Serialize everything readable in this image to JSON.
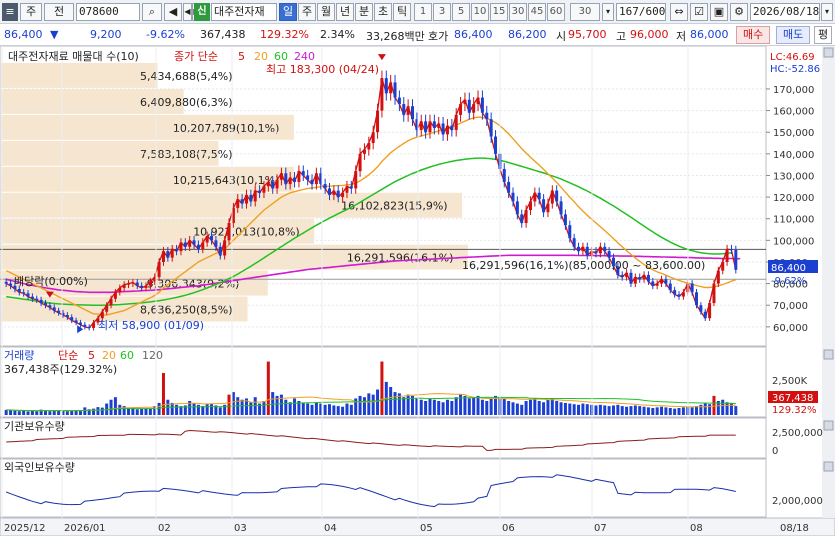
{
  "toolbar": {
    "menu_glyph": "≡",
    "type_label": "주",
    "mode_label": "전",
    "code": "078600",
    "search_glyph": "🔍",
    "sound_glyph": "◀",
    "nav_prev": "◀",
    "nav_next": "▶",
    "credit_badge": "신",
    "company_name": "대주전자재",
    "periods": [
      "일",
      "주",
      "월",
      "년",
      "분",
      "초",
      "틱"
    ],
    "active_period": "일",
    "minute_options": [
      "1",
      "3",
      "5",
      "10",
      "15",
      "30",
      "45",
      "60"
    ],
    "custom_value": "30",
    "count_display": "167/600",
    "date": "2026/08/18"
  },
  "quote": {
    "price": "86,400",
    "direction": "▼",
    "change": "9,200",
    "change_pct": "-9.62%",
    "volume": "367,438",
    "volume_ratio": "129.32%",
    "turnover_pct": "2.34%",
    "amount": "33,268백만",
    "ask_label": "호가",
    "ask": "86,400",
    "bid": "86,200",
    "open_label": "시",
    "open": "95,700",
    "high_label": "고",
    "high": "96,000",
    "low_label": "저",
    "low": "86,000",
    "buy_label": "매수",
    "sell_label": "매도",
    "eval_label": "평"
  },
  "colors": {
    "up": "#d21010",
    "down": "#1a3fd1",
    "ma5": "#d21010",
    "ma20": "#f0a020",
    "ma60": "#22c022",
    "ma240": "#d01ad0",
    "volbar": "#1a3fd1",
    "band": "#f6e6d0"
  },
  "main_panel": {
    "legend_title": "대주전자재료 매물대 수(10)",
    "legend_close": "종가 단순",
    "legend_ma": [
      "5",
      "20",
      "60",
      "240"
    ],
    "lc": "LC:46.69",
    "hc": "HC:-52.86",
    "high_mark": "최고 183,300 (04/24)",
    "low_mark": "최저 58,900 (01/09)",
    "dividend": "배당락(0.00%)",
    "current_price_tag": "86,400",
    "current_pct_tag": "-9.62%",
    "range_note": "16,291,596(16,1%)(85,000.00 ~ 83,600.00)"
  },
  "chart_data": {
    "type": "candlestick",
    "y_ticks": [
      60000,
      70000,
      80000,
      90000,
      100000,
      110000,
      120000,
      130000,
      140000,
      150000,
      160000,
      170000
    ],
    "y_tick_labels": [
      "60,000",
      "70,000",
      "80,000",
      "90,000",
      "100,000",
      "110,000",
      "120,000",
      "130,000",
      "140,000",
      "150,000",
      "160,000",
      "170,000"
    ],
    "ylim": [
      53000,
      188000
    ],
    "x_labels": [
      "2025/12",
      "2026/01",
      "02",
      "03",
      "04",
      "05",
      "06",
      "07",
      "08",
      "08/18"
    ],
    "volume_profile": [
      {
        "label": "5,434,688(5,4%)",
        "price": 176000,
        "ratio": 0.054
      },
      {
        "label": "6,409,880(6,3%)",
        "price": 164000,
        "ratio": 0.063
      },
      {
        "label": "10,207,789(10,1%)",
        "price": 152000,
        "ratio": 0.101
      },
      {
        "label": "7,583,108(7,5%)",
        "price": 140000,
        "ratio": 0.075
      },
      {
        "label": "10,215,643(10,1%)",
        "price": 128000,
        "ratio": 0.101
      },
      {
        "label": "16,102,823(15,9%)",
        "price": 116000,
        "ratio": 0.159
      },
      {
        "label": "10,922,013(10,8%)",
        "price": 104000,
        "ratio": 0.108
      },
      {
        "label": "16,291,596(16,1%)",
        "price": 92000,
        "ratio": 0.161
      },
      {
        "label": "9,306,343(9,2%)",
        "price": 80000,
        "ratio": 0.092
      },
      {
        "label": "8,636,250(8,5%)",
        "price": 68000,
        "ratio": 0.085
      }
    ],
    "close": [
      80000,
      79000,
      77500,
      76000,
      75500,
      74000,
      73000,
      72500,
      71000,
      70000,
      69000,
      67500,
      66500,
      65500,
      64500,
      63000,
      62000,
      61000,
      60000,
      59500,
      62000,
      64000,
      67000,
      70000,
      73000,
      76000,
      78000,
      79500,
      80000,
      80500,
      79000,
      78000,
      79000,
      81000,
      83000,
      90000,
      95000,
      92000,
      96000,
      95000,
      99000,
      97000,
      100000,
      98000,
      96000,
      99000,
      102000,
      100000,
      97000,
      93000,
      100000,
      108000,
      115000,
      119000,
      117000,
      121000,
      118000,
      123000,
      122000,
      125000,
      127000,
      124000,
      128000,
      131000,
      126000,
      129000,
      127000,
      132000,
      130000,
      128000,
      126000,
      131000,
      126000,
      124000,
      121000,
      123000,
      120000,
      122000,
      125000,
      124000,
      132000,
      140000,
      142000,
      145000,
      150000,
      160000,
      175000,
      168000,
      173000,
      166000,
      163000,
      158000,
      162000,
      156000,
      151000,
      155000,
      150000,
      155000,
      152000,
      154000,
      149000,
      153000,
      151000,
      158000,
      163000,
      165000,
      159000,
      163000,
      166000,
      159000,
      156000,
      148000,
      140000,
      133000,
      127000,
      122000,
      118000,
      112000,
      108000,
      114000,
      118000,
      122000,
      119000,
      113000,
      117000,
      123000,
      118000,
      112000,
      107000,
      101000,
      97000,
      95000,
      97000,
      93000,
      95000,
      94000,
      97000,
      95000,
      92000,
      88000,
      84000,
      83000,
      85000,
      80000,
      83000,
      82000,
      84000,
      81000,
      79000,
      80000,
      82000,
      80000,
      77000,
      75000,
      74000,
      76000,
      80000,
      76000,
      70000,
      67000,
      64000,
      71000,
      80000,
      86000,
      90000,
      96000,
      95600,
      86400
    ],
    "ma20": [
      86000,
      85000,
      84000,
      83000,
      82000,
      81000,
      80000,
      79000,
      78000,
      77000,
      76000,
      75000,
      74000,
      73000,
      72000,
      71000,
      70000,
      69000,
      68000,
      67000,
      66000,
      66000,
      65500,
      65500,
      66000,
      66500,
      67000,
      67500,
      68500,
      69500,
      70500,
      71500,
      72500,
      73500,
      74500,
      76000,
      78000,
      79500,
      81000,
      82500,
      84000,
      85500,
      87000,
      88500,
      90000,
      91000,
      92000,
      93000,
      94000,
      94500,
      96000,
      98000,
      100000,
      102000,
      104000,
      106000,
      108000,
      110000,
      112000,
      114000,
      115500,
      117000,
      118500,
      120000,
      121000,
      122000,
      122500,
      123000,
      123500,
      124000,
      124200,
      124500,
      124800,
      125000,
      125000,
      125200,
      125300,
      125400,
      125600,
      125800,
      126500,
      127500,
      128800,
      130300,
      132000,
      134000,
      136500,
      138500,
      140500,
      142000,
      143500,
      144800,
      146000,
      147000,
      147700,
      148300,
      148800,
      149400,
      150000,
      150600,
      151200,
      151800,
      152500,
      153300,
      154200,
      155100,
      156000,
      156600,
      157000,
      156800,
      156400,
      155600,
      154500,
      153000,
      151200,
      149200,
      147000,
      144700,
      142400,
      140400,
      138400,
      136600,
      134800,
      132800,
      130800,
      128800,
      126800,
      124500,
      122200,
      120000,
      117800,
      115600,
      113500,
      111600,
      109800,
      108000,
      106300,
      104500,
      102700,
      100800,
      98800,
      97000,
      95200,
      93500,
      91800,
      90300,
      88800,
      87500,
      86400,
      85400,
      84700,
      83900,
      83000,
      82200,
      81500,
      80800,
      80300,
      79700,
      79100,
      78600,
      78200,
      78200,
      78500,
      79000,
      79600,
      80300,
      81100,
      81800
    ],
    "ma60": [
      74000,
      73700,
      73400,
      73100,
      72800,
      72500,
      72200,
      71900,
      71600,
      71300,
      71000,
      70800,
      70600,
      70500,
      70400,
      70300,
      70200,
      70150,
      70100,
      70050,
      70000,
      70000,
      70000,
      70050,
      70100,
      70200,
      70300,
      70450,
      70600,
      70750,
      70900,
      71100,
      71300,
      71550,
      71800,
      72100,
      72400,
      72800,
      73200,
      73600,
      74100,
      74600,
      75200,
      75800,
      76500,
      77200,
      78000,
      78800,
      79600,
      80400,
      81300,
      82300,
      83300,
      84400,
      85600,
      86800,
      88000,
      89300,
      90600,
      91900,
      93200,
      94500,
      95800,
      97100,
      98400,
      99700,
      101000,
      102200,
      103400,
      104600,
      105800,
      107000,
      108100,
      109200,
      110300,
      111300,
      112300,
      113300,
      114300,
      115300,
      116400,
      117600,
      118800,
      120000,
      121200,
      122400,
      123600,
      124800,
      126000,
      127100,
      128100,
      129100,
      130000,
      130900,
      131700,
      132500,
      133200,
      133900,
      134500,
      135100,
      135600,
      136100,
      136500,
      136900,
      137200,
      137500,
      137700,
      137900,
      138000,
      138000,
      137900,
      137700,
      137400,
      137000,
      136500,
      136000,
      135400,
      134800,
      134200,
      133600,
      133000,
      132400,
      131800,
      131200,
      130500,
      129800,
      129100,
      128300,
      127500,
      126600,
      125700,
      124800,
      123800,
      122800,
      121700,
      120600,
      119500,
      118300,
      117100,
      115900,
      114600,
      113300,
      112000,
      110700,
      109300,
      107900,
      106600,
      105200,
      103900,
      102600,
      101400,
      100300,
      99200,
      98200,
      97300,
      96500,
      95800,
      95200,
      94700,
      94300,
      94000,
      93800,
      93700,
      93700,
      93800,
      94000,
      94200
    ],
    "ma240": [
      82000,
      81500,
      81000,
      80500,
      80000,
      79600,
      79200,
      78800,
      78400,
      78000,
      77700,
      77400,
      77100,
      76900,
      76700,
      76500,
      76300,
      76200,
      76100,
      76000,
      76000,
      76000,
      76000,
      76000,
      76000,
      76100,
      76200,
      76300,
      76400,
      76500,
      76600,
      76700,
      76800,
      76900,
      77000,
      77200,
      77400,
      77600,
      77800,
      78000,
      78200,
      78400,
      78600,
      78800,
      79000,
      79300,
      79600,
      79900,
      80200,
      80500,
      80800,
      81100,
      81400,
      81700,
      82000,
      82300,
      82600,
      82900,
      83200,
      83500,
      83800,
      84100,
      84400,
      84700,
      85000,
      85300,
      85600,
      85900,
      86200,
      86500,
      86700,
      86900,
      87100,
      87300,
      87500,
      87700,
      87900,
      88100,
      88300,
      88500,
      88700,
      88900,
      89100,
      89300,
      89500,
      89700,
      89900,
      90100,
      90300,
      90500,
      90600,
      90700,
      90800,
      90900,
      91000,
      91100,
      91200,
      91300,
      91400,
      91500,
      91600,
      91700,
      91800,
      91900,
      92000,
      92100,
      92200,
      92300,
      92400,
      92500,
      92600,
      92700,
      92800,
      92900,
      93000,
      93100,
      93100,
      93100,
      93100,
      93100,
      93100,
      93100,
      93100,
      93100,
      93100,
      93100,
      93100,
      93100,
      93100,
      93100,
      93100,
      93000,
      93000,
      93000,
      93000,
      92900,
      92900,
      92900,
      92800,
      92800,
      92800,
      92700,
      92700,
      92700,
      92600,
      92600,
      92500,
      92500,
      92400,
      92400,
      92300,
      92300,
      92200,
      92200,
      92100,
      92100,
      92000,
      92000,
      91900,
      91900,
      91800,
      91800,
      91700,
      91700,
      91600,
      91600,
      91600,
      91500,
      91500
    ],
    "volume_legend": [
      "거래량",
      "단순",
      "5",
      "20",
      "60",
      "120"
    ],
    "volume_caption": "367,438주(129.32%)",
    "volume_ticks": [
      "2,500K"
    ],
    "volume_tag": "367,438",
    "volume_tag_pct": "129.32%",
    "volume": [
      40,
      38,
      35,
      30,
      36,
      28,
      33,
      30,
      42,
      35,
      30,
      38,
      33,
      36,
      30,
      34,
      39,
      35,
      60,
      45,
      50,
      62,
      58,
      90,
      120,
      140,
      80,
      70,
      55,
      60,
      45,
      50,
      52,
      48,
      70,
      95,
      330,
      120,
      95,
      80,
      70,
      75,
      110,
      90,
      80,
      70,
      85,
      90,
      75,
      60,
      80,
      160,
      180,
      140,
      120,
      130,
      100,
      140,
      90,
      110,
      420,
      180,
      150,
      160,
      120,
      100,
      130,
      110,
      95,
      90,
      80,
      100,
      90,
      80,
      85,
      75,
      70,
      65,
      90,
      80,
      130,
      150,
      140,
      170,
      160,
      200,
      420,
      260,
      220,
      180,
      170,
      140,
      160,
      150,
      130,
      120,
      110,
      130,
      120,
      110,
      100,
      120,
      110,
      140,
      160,
      150,
      130,
      140,
      150,
      120,
      110,
      130,
      150,
      140,
      130,
      110,
      100,
      90,
      80,
      110,
      120,
      130,
      110,
      100,
      120,
      130,
      110,
      100,
      95,
      90,
      85,
      80,
      90,
      85,
      80,
      75,
      80,
      75,
      70,
      75,
      80,
      70,
      65,
      70,
      75,
      70,
      65,
      60,
      55,
      60,
      65,
      60,
      55,
      50,
      55,
      60,
      65,
      60,
      70,
      80,
      90,
      85,
      150,
      110,
      120,
      100,
      90,
      70
    ],
    "volume_spikes": [
      {
        "i": 36,
        "v": 330
      },
      {
        "i": 60,
        "v": 420
      },
      {
        "i": 86,
        "v": 420
      },
      {
        "i": 51,
        "v": 180
      },
      {
        "i": 162,
        "v": 150
      }
    ],
    "inst_label": "기관보유수량",
    "inst_ticks": [
      "2,500,000",
      "0"
    ],
    "foreign_label": "외국인보유수량",
    "foreign_ticks": [
      "2,000,000"
    ]
  }
}
